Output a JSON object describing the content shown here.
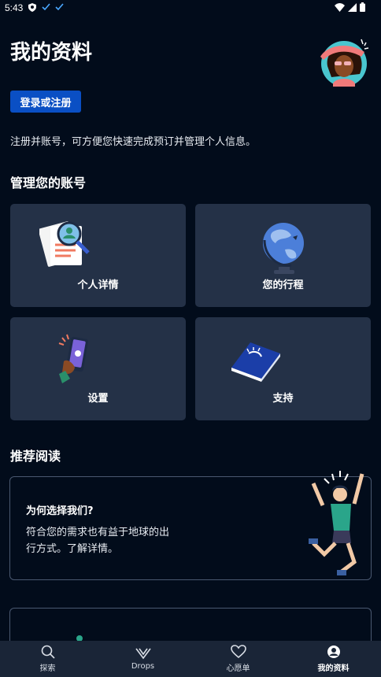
{
  "status_bar": {
    "time": "5:43"
  },
  "header": {
    "title": "我的资料"
  },
  "login_button": "登录或注册",
  "intro_text": "注册并账号，可方便您快速完成预订并管理个人信息。",
  "manage_section": {
    "title": "管理您的账号",
    "cards": [
      {
        "label": "个人详情",
        "icon": "personal-details-icon"
      },
      {
        "label": "您的行程",
        "icon": "globe-icon"
      },
      {
        "label": "设置",
        "icon": "phone-settings-icon"
      },
      {
        "label": "支持",
        "icon": "book-icon"
      }
    ]
  },
  "reading_section": {
    "title": "推荐阅读",
    "article": {
      "title": "为何选择我们?",
      "text_line1": "符合您的需求也有益于地球的出",
      "text_line2": "行方式。了解详情。"
    }
  },
  "bottom_nav": [
    {
      "label": "探索",
      "icon": "search-icon"
    },
    {
      "label": "Drops",
      "icon": "drops-icon"
    },
    {
      "label": "心愿单",
      "icon": "heart-icon"
    },
    {
      "label": "我的资料",
      "icon": "profile-icon",
      "active": true
    }
  ],
  "colors": {
    "background": "#020c1b",
    "card": "#243147",
    "accent": "#0a4fc4",
    "nav": "#1a2537"
  }
}
